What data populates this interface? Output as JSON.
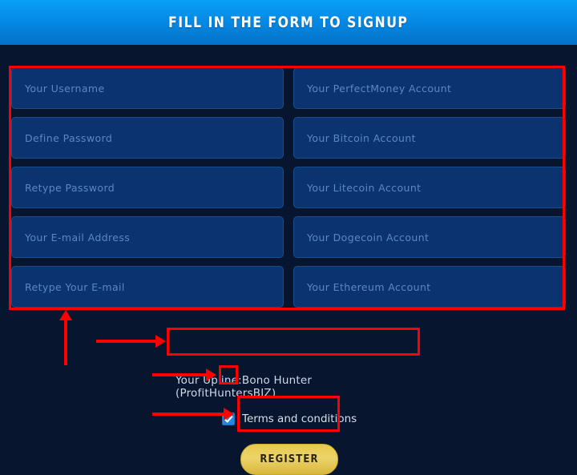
{
  "header": {
    "title": "FILL IN THE FORM TO SIGNUP",
    "gradient_top": "#0aa0f7",
    "gradient_bottom": "#0372c8"
  },
  "colors": {
    "page_background": "#07152e",
    "field_background": "#0b3370",
    "field_border": "#1a4d8f",
    "placeholder_text": "#5b87c4",
    "annotation_red": "#fe0000",
    "button_gold": "#ecd469",
    "checkbox_blue": "#1f8ae0"
  },
  "form": {
    "left_column": [
      {
        "placeholder": "Your Username"
      },
      {
        "placeholder": "Define Password"
      },
      {
        "placeholder": "Retype Password"
      },
      {
        "placeholder": "Your E-mail Address"
      },
      {
        "placeholder": "Retype Your E-mail"
      }
    ],
    "right_column": [
      {
        "placeholder": "Your PerfectMoney Account"
      },
      {
        "placeholder": "Your Bitcoin Account"
      },
      {
        "placeholder": "Your Litecoin Account"
      },
      {
        "placeholder": "Your Dogecoin Account"
      },
      {
        "placeholder": "Your Ethereum Account"
      }
    ]
  },
  "upline": {
    "text": "Your Upline:Bono Hunter (ProfitHuntersBIZ)"
  },
  "terms": {
    "label": "Terms and conditions",
    "checked": true
  },
  "register": {
    "label": "REGISTER"
  }
}
